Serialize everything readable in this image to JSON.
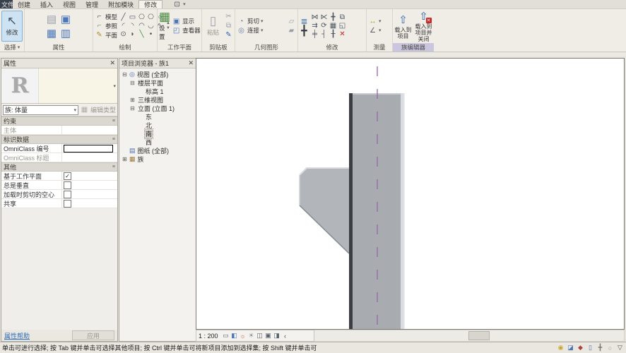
{
  "tabbar": {
    "file_tab": "文件",
    "tabs": [
      "创建",
      "插入",
      "视图",
      "管理",
      "附加模块",
      "修改"
    ],
    "active_tab": "修改",
    "panel_toggle_glyph": "⊡",
    "panel_toggle_caret": "▾"
  },
  "ribbon": {
    "select_panel": {
      "modify_button": "修改",
      "label": "选择",
      "caret": "▾"
    },
    "properties_panel": {
      "label": "属性",
      "icons": [
        {
          "name": "properties-palette-icon",
          "glyph": "▤",
          "color": "#9aa0a8"
        },
        {
          "name": "family-category-icon",
          "glyph": "▣",
          "color": "#4a76b8"
        },
        {
          "name": "family-types-icon",
          "glyph": "▦",
          "color": "#4a76b8"
        },
        {
          "name": "family-parameters-icon",
          "glyph": "▥",
          "color": "#4a76b8"
        }
      ]
    },
    "draw_panel": {
      "label": "绘制",
      "modes": [
        {
          "label": "模型",
          "icon": {
            "name": "model-line-icon",
            "glyph": "⌐",
            "color": "#4a5560"
          }
        },
        {
          "label": "参照",
          "icon": {
            "name": "reference-line-icon",
            "glyph": "⌐",
            "color": "#7a9a6a"
          }
        },
        {
          "label": "平面",
          "icon": {
            "name": "reference-plane-icon",
            "glyph": "✎",
            "color": "#b08d2a"
          }
        }
      ],
      "tools": [
        {
          "name": "line-tool-icon",
          "glyph": "╱"
        },
        {
          "name": "rectangle-tool-icon",
          "glyph": "▭"
        },
        {
          "name": "inscribed-polygon-tool-icon",
          "glyph": "⎔"
        },
        {
          "name": "circumscribed-polygon-tool-icon",
          "glyph": "⎔"
        },
        {
          "name": "circle-tool-icon",
          "glyph": "○"
        },
        {
          "name": "start-end-radius-arc-tool-icon",
          "glyph": "◜"
        },
        {
          "name": "center-ends-arc-tool-icon",
          "glyph": "◝"
        },
        {
          "name": "tangent-arc-tool-icon",
          "glyph": "◠"
        },
        {
          "name": "fillet-arc-tool-icon",
          "glyph": "◡"
        },
        {
          "name": "spline-tool-icon",
          "glyph": "∿"
        },
        {
          "name": "ellipse-tool-icon",
          "glyph": "⊙"
        },
        {
          "name": "partial-ellipse-tool-icon",
          "glyph": "◗"
        },
        {
          "name": "pick-lines-tool-icon",
          "glyph": "╲",
          "color": "#3a8a3a"
        },
        {
          "name": "point-tool-icon",
          "glyph": "•"
        }
      ]
    },
    "workplane_panel": {
      "label": "工作平面",
      "set_button": "设置",
      "show_button": "显示",
      "viewer_button": "查看器",
      "set_icon": {
        "name": "set-workplane-icon",
        "glyph": "▦",
        "color": "#4a8c3f"
      },
      "show_icon": {
        "name": "show-workplane-icon",
        "glyph": "▣",
        "color": "#4a76b8"
      },
      "viewer_icon": {
        "name": "workplane-viewer-icon",
        "glyph": "◰",
        "color": "#4a76b8"
      }
    },
    "clipboard_panel": {
      "label": "剪贴板",
      "paste_button": "粘贴",
      "paste_icon": {
        "name": "paste-icon",
        "glyph": "▯",
        "color": "#9aa0a8"
      },
      "icons": [
        {
          "name": "cut-icon",
          "glyph": "✂",
          "color": "#9aa0a8"
        },
        {
          "name": "copy-icon",
          "glyph": "⧉",
          "color": "#9aa0a8"
        },
        {
          "name": "match-type-icon",
          "glyph": "✎",
          "color": "#2c66b0"
        }
      ]
    },
    "geometry_panel": {
      "label": "几何图形",
      "cut_button": "剪切",
      "join_button": "连接",
      "caret": "▾",
      "cut_icon": {
        "name": "cut-geometry-icon",
        "glyph": "◔",
        "color": "#6a7fa8"
      },
      "join_icon": {
        "name": "join-geometry-icon",
        "glyph": "◎",
        "color": "#6a7fa8"
      },
      "icons": [
        {
          "name": "solid-forms-icon",
          "glyph": "▱",
          "color": "#9aa0a8"
        },
        {
          "name": "void-forms-icon",
          "glyph": "▰",
          "color": "#9aa0a8"
        }
      ]
    },
    "modify_panel": {
      "label": "修改",
      "align_icon": {
        "name": "align-icon",
        "glyph": "≣",
        "color": "#4a76b8"
      },
      "move_icon": {
        "name": "move-crosshair-icon",
        "glyph": "╋",
        "color": "#3a3f45"
      },
      "tools": [
        {
          "name": "mirror-pick-axis-icon",
          "glyph": "⋈"
        },
        {
          "name": "mirror-draw-axis-icon",
          "glyph": "⋉"
        },
        {
          "name": "move-icon",
          "glyph": "╋"
        },
        {
          "name": "copy-icon",
          "glyph": "⧉"
        },
        {
          "name": "offset-icon",
          "glyph": "⇉"
        },
        {
          "name": "rotate-icon",
          "glyph": "⟳"
        },
        {
          "name": "array-icon",
          "glyph": "▦"
        },
        {
          "name": "scale-icon",
          "glyph": "◱"
        },
        {
          "name": "split-icon",
          "glyph": "╪"
        },
        {
          "name": "trim-icon",
          "glyph": "┤"
        },
        {
          "name": "pin-icon",
          "glyph": "╂"
        },
        {
          "name": "delete-icon",
          "glyph": "✕",
          "color": "#cc2222"
        }
      ]
    },
    "measure_panel": {
      "label": "测量",
      "caret": "▾",
      "length_icon": {
        "name": "measure-length-icon",
        "glyph": "↔",
        "color": "#b8960c"
      },
      "angle_icon": {
        "name": "measure-angle-icon",
        "glyph": "∠",
        "color": "#55606a"
      }
    },
    "family_panel": {
      "label": "族编辑器",
      "load_line1": "载入到",
      "load_line2": "项目",
      "loadclose_line1": "载入到",
      "loadclose_line2": "项目并关闭",
      "load_icon_glyph": "⇧",
      "badge_glyph": "✕"
    }
  },
  "properties": {
    "title": "属性",
    "close_glyph": "✕",
    "preview_letter": "R",
    "dropdown_caret": "▾",
    "type_selector": "族: 体量",
    "edit_type": "编辑类型",
    "edit_type_icon_glyph": "▦",
    "groups": [
      {
        "title": "约束",
        "rows": [
          {
            "label": "主体",
            "type": "text",
            "value": "",
            "disabled": true
          }
        ]
      },
      {
        "title": "标识数据",
        "rows": [
          {
            "label": "OmniClass 编号",
            "type": "input",
            "value": ""
          },
          {
            "label": "OmniClass 标题",
            "type": "text",
            "value": "",
            "disabled": true
          }
        ]
      },
      {
        "title": "其他",
        "rows": [
          {
            "label": "基于工作平面",
            "type": "check",
            "checked": true
          },
          {
            "label": "总是垂直",
            "type": "check",
            "checked": false
          },
          {
            "label": "加载时剪切的空心",
            "type": "check",
            "checked": false
          },
          {
            "label": "共享",
            "type": "check",
            "checked": false
          }
        ]
      }
    ],
    "help_link": "属性帮助",
    "apply_button": "应用"
  },
  "browser": {
    "title": "项目浏览器 - 族1",
    "close_glyph": "✕",
    "tree": [
      {
        "label": "视图 (全部)",
        "level": 0,
        "expander": "-",
        "icon": "views",
        "icon_glyph": "◎",
        "icon_color": "#4a6da8"
      },
      {
        "label": "楼层平面",
        "level": 1,
        "expander": "-"
      },
      {
        "label": "标高 1",
        "level": 2
      },
      {
        "label": "三维视图",
        "level": 1,
        "expander": "+"
      },
      {
        "label": "立面 (立面 1)",
        "level": 1,
        "expander": "-"
      },
      {
        "label": "东",
        "level": 2
      },
      {
        "label": "北",
        "level": 2
      },
      {
        "label": "南",
        "level": 2,
        "selected": true
      },
      {
        "label": "西",
        "level": 2
      },
      {
        "label": "图纸 (全部)",
        "level": 0,
        "icon": "sheets",
        "icon_glyph": "▤",
        "icon_color": "#4a6da8"
      },
      {
        "label": "族",
        "level": 0,
        "expander": "+",
        "icon": "families",
        "icon_glyph": "▦",
        "icon_color": "#a07840"
      }
    ]
  },
  "canvas": {
    "centerline_color": "#9a64ae",
    "mass_body_color": "#a8abb0",
    "mass_dark_edge_color": "#3a3d41",
    "mass_light_edge_color": "#d9dce0"
  },
  "view_bar": {
    "scale": "1 : 200",
    "icons": [
      {
        "name": "detail-level-icon",
        "glyph": "▭",
        "color": "#55606a"
      },
      {
        "name": "visual-style-icon",
        "glyph": "◧",
        "color": "#4a76b8"
      },
      {
        "name": "sun-path-icon",
        "glyph": "☼",
        "color": "#c05545"
      },
      {
        "name": "shadows-icon",
        "glyph": "☀",
        "color": "#8a8f95"
      },
      {
        "name": "crop-view-icon",
        "glyph": "◫",
        "color": "#55606a"
      },
      {
        "name": "crop-region-icon",
        "glyph": "▣",
        "color": "#55606a"
      },
      {
        "name": "hidden-elements-icon",
        "glyph": "◨",
        "color": "#55606a"
      },
      {
        "name": "collapse-view-bar-icon",
        "glyph": "‹",
        "color": "#444"
      }
    ]
  },
  "statusbar": {
    "hint": "单击可进行选择; 按 Tab 键并单击可选择其他项目; 按 Ctrl 键并单击可将新项目添加到选择集; 按 Shift 键并单击可",
    "icons": [
      {
        "name": "worksharing-display-icon",
        "glyph": "◉",
        "color": "#c9a42a"
      },
      {
        "name": "editing-requests-icon",
        "glyph": "◪",
        "color": "#4a76b8"
      },
      {
        "name": "active-workset-icon",
        "glyph": "◆",
        "color": "#b04040"
      },
      {
        "name": "design-options-icon",
        "glyph": "▯",
        "color": "#4a76b8"
      },
      {
        "name": "press-drag-icon",
        "glyph": "╋",
        "color": "#777"
      },
      {
        "name": "editable-only-icon",
        "glyph": "○",
        "color": "#999"
      },
      {
        "name": "filter-icon",
        "glyph": "▽",
        "color": "#555"
      }
    ]
  }
}
